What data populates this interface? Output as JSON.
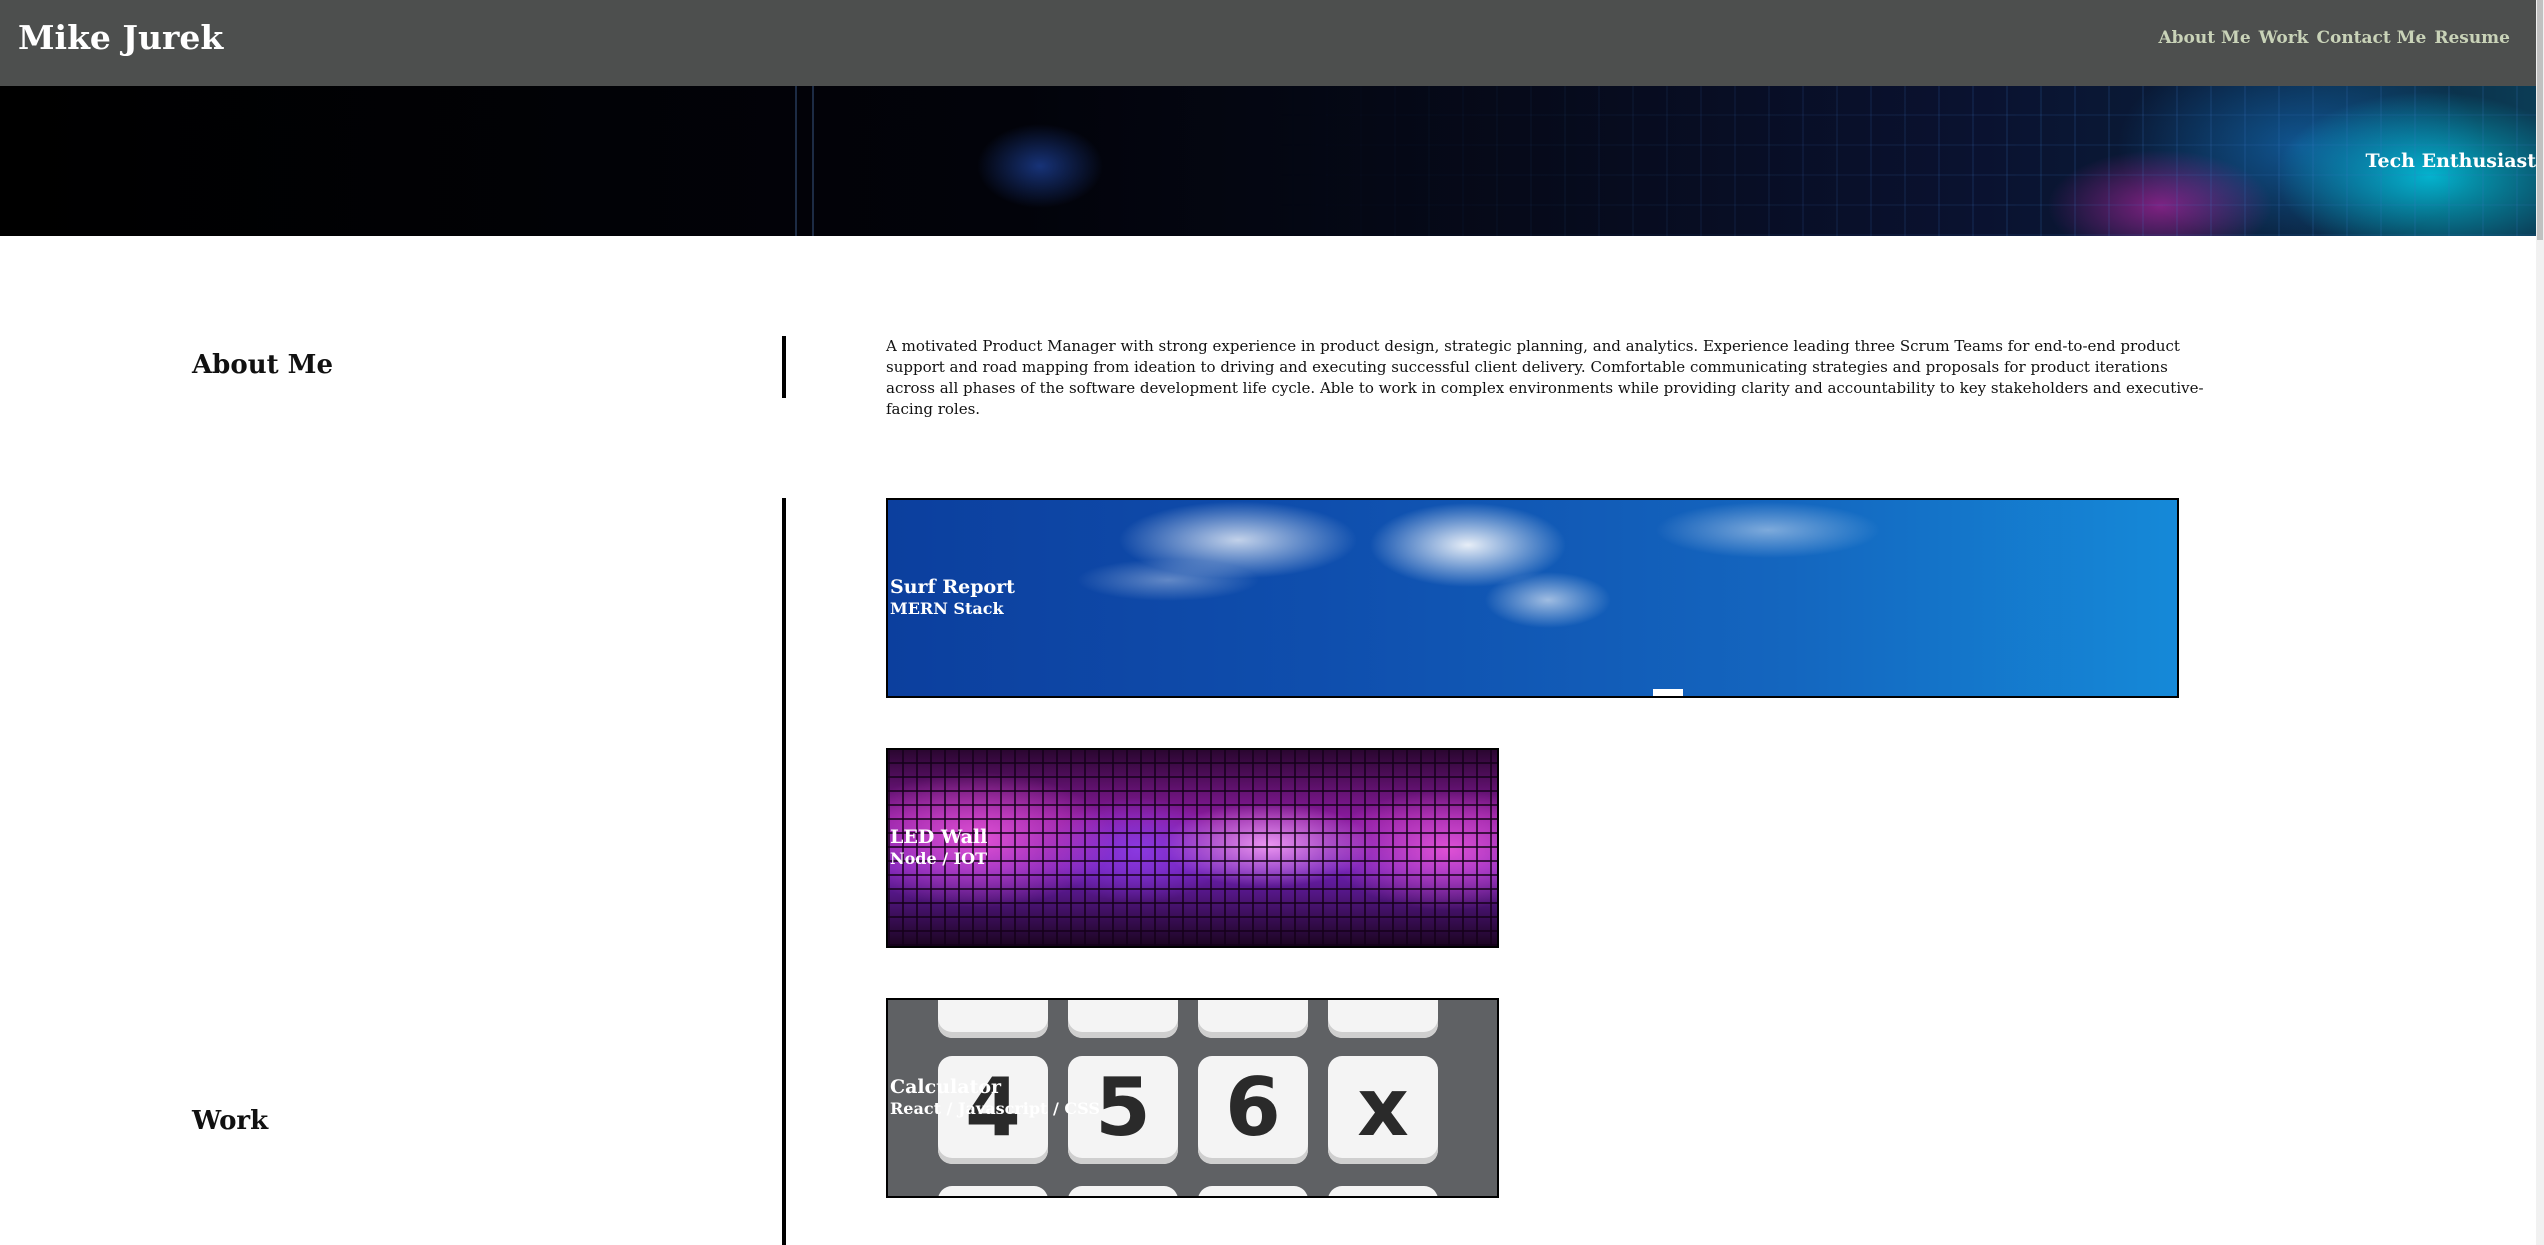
{
  "site": {
    "title": "Mike Jurek",
    "nav": [
      "About Me",
      "Work",
      "Contact Me",
      "Resume"
    ]
  },
  "banner": {
    "tagline": "Tech Enthusiast"
  },
  "about": {
    "heading": "About Me",
    "text": "A motivated Product Manager with strong experience in product design, strategic planning, and analytics. Experience leading three Scrum Teams for end-to-end product support and road mapping from ideation to driving and executing successful client delivery. Comfortable communicating strategies and proposals for product iterations across all phases of the software development life cycle. Able to work in complex environments while providing clarity and accountability to key stakeholders and executive-facing roles."
  },
  "work": {
    "heading": "Work",
    "projects": [
      {
        "title": "Surf Report",
        "subtitle": "MERN Stack"
      },
      {
        "title": "LED Wall",
        "subtitle": "Node / IOT"
      },
      {
        "title": "Calculator",
        "subtitle": "React / Javascript / CSS"
      }
    ],
    "calculator_keys": [
      "4",
      "5",
      "6",
      "x"
    ]
  },
  "colors": {
    "header_bg": "#4d4f4e",
    "nav_text": "#c9d3b8",
    "divider": "#000000"
  }
}
